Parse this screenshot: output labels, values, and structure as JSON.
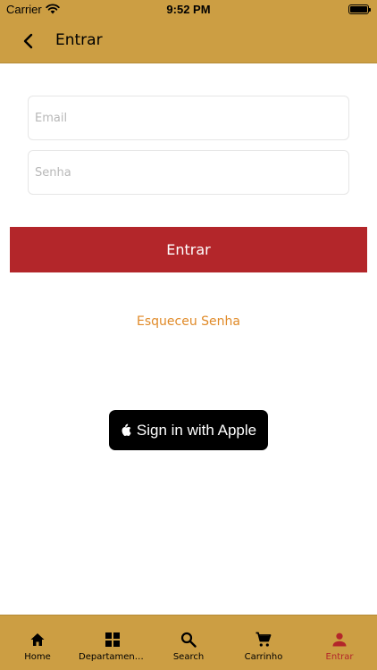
{
  "status_bar": {
    "carrier": "Carrier",
    "time": "9:52 PM"
  },
  "nav": {
    "title": "Entrar",
    "back_icon": "chevron-left-icon"
  },
  "form": {
    "email_placeholder": "Email",
    "email_value": "",
    "password_placeholder": "Senha",
    "password_value": "",
    "submit_label": "Entrar",
    "forgot_label": "Esqueceu Senha",
    "apple_label": "Sign in with Apple"
  },
  "tabs": [
    {
      "label": "Home",
      "icon": "home-icon"
    },
    {
      "label": "Departamentos",
      "icon": "grid-icon"
    },
    {
      "label": "Search",
      "icon": "search-icon"
    },
    {
      "label": "Carrinho",
      "icon": "cart-icon"
    },
    {
      "label": "Entrar",
      "icon": "person-icon",
      "active": true
    }
  ],
  "colors": {
    "brand_gold": "#CC9E43",
    "primary_red": "#B3262A",
    "link_orange": "#E08A28",
    "apple_black": "#000000"
  }
}
